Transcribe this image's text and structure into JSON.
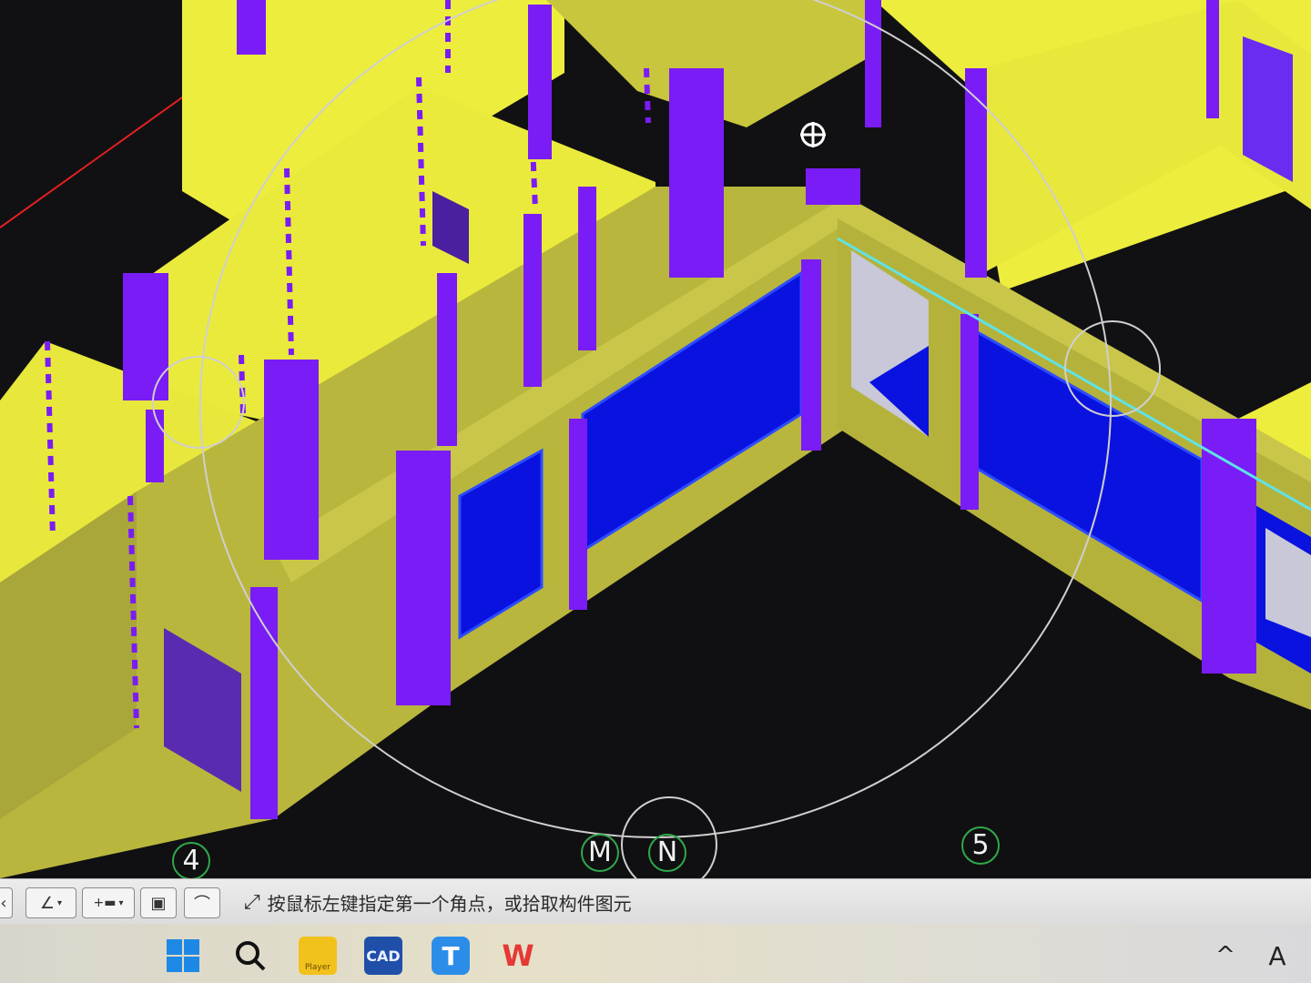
{
  "viewport": {
    "background": "#111114",
    "wall_color": "#e8e83c",
    "wall_shade": "#b5b23c",
    "column_color": "#7a1cf5",
    "window_color": "#0a12e0",
    "axis_line_color": "#e02020",
    "orbit_circle_color": "#cfcfcf",
    "axis_labels": [
      "4",
      "M",
      "N",
      "5"
    ],
    "cursor_icon": "orbit-cursor-icon"
  },
  "command_bar": {
    "tools": [
      {
        "name": "angle-tool",
        "icon": "∠"
      },
      {
        "name": "insert-tool",
        "icon": "+▬"
      },
      {
        "name": "select-tool",
        "icon": "▣"
      },
      {
        "name": "arc-tool",
        "icon": "⌒"
      }
    ],
    "prompt": "按鼠标左键指定第一个角点，或拾取构件图元"
  },
  "taskbar": {
    "apps": [
      {
        "name": "start",
        "label": ""
      },
      {
        "name": "search",
        "label": ""
      },
      {
        "name": "player",
        "label": "Player"
      },
      {
        "name": "cad",
        "label": "CAD"
      },
      {
        "name": "t-app",
        "label": "T"
      },
      {
        "name": "wps",
        "label": "W"
      }
    ],
    "tray_chevron": "^",
    "ime_indicator": "A"
  }
}
